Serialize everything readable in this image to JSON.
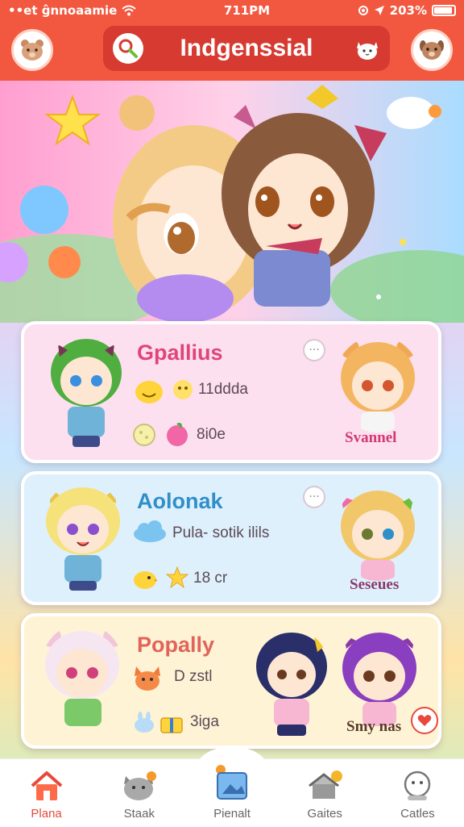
{
  "status_bar": {
    "carrier": "••et ĝnnoaamie",
    "time": "711PM",
    "battery": "203%"
  },
  "header": {
    "title": "Indgenssial"
  },
  "cards": [
    {
      "name": "Gpallius",
      "info1": "11ddda",
      "info2": "8i0e",
      "tag": "Svannel",
      "name_color": "#e0457a",
      "bg": "#fde0ef"
    },
    {
      "name": "Aolonak",
      "info1": "Pula- sotik ilils",
      "info2": "18 cr",
      "tag": "Seseues",
      "name_color": "#2f8fc9",
      "bg": "#dff0fd"
    },
    {
      "name": "Popally",
      "info1": "D zstl",
      "info2": "3iga",
      "tag": "Smy nas",
      "name_color": "#e0645a",
      "bg": "#fff3d6"
    }
  ],
  "nav": [
    {
      "label": "Plana",
      "icon": "home-icon",
      "active": true
    },
    {
      "label": "Staak",
      "icon": "pet-icon",
      "active": false
    },
    {
      "label": "Pienalt",
      "icon": "photo-icon",
      "active": false
    },
    {
      "label": "Gaites",
      "icon": "house-icon",
      "active": false
    },
    {
      "label": "Catles",
      "icon": "profile-icon",
      "active": false
    }
  ],
  "colors": {
    "accent": "#f2583f",
    "active_nav": "#e8493a"
  }
}
